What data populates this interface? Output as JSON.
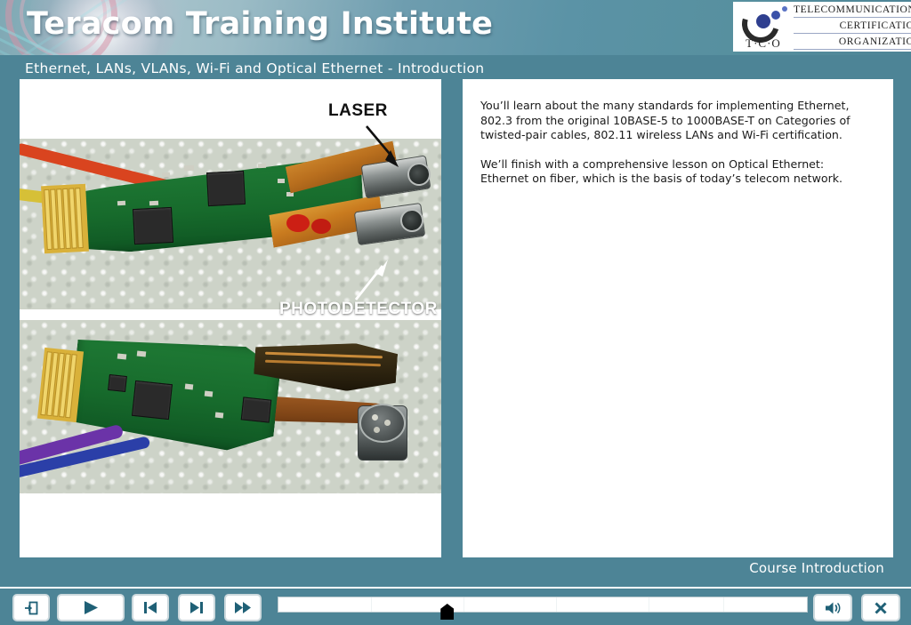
{
  "header": {
    "brand_title": "Teracom Training Institute",
    "subtitle": "Ethernet, LANs, VLANs, Wi-Fi and Optical Ethernet - Introduction",
    "logo": {
      "mark_text": "T·C·O",
      "line1": "TELECOMMUNICATIONS",
      "line2": "CERTIFICATION",
      "line3": "ORGANIZATION"
    }
  },
  "slide": {
    "image_callouts": {
      "laser": "LASER",
      "photodetector": "PHOTODETECTOR"
    },
    "body_paragraph_1": "You’ll learn about the many standards for implementing Ethernet, 802.3 from the original 10BASE-5 to 1000BASE-T on Categories of twisted-pair cables, 802.11 wireless LANs and Wi-Fi certification.",
    "body_paragraph_2": "We’ll finish with a comprehensive lesson on Optical Ethernet: Ethernet on fiber, which is the basis of today’s telecom network.",
    "course_label": "Course Introduction"
  },
  "controls": {
    "exit": "exit-icon",
    "play": "play-icon",
    "previous": "previous-icon",
    "next": "next-icon",
    "fast_forward": "fast-forward-icon",
    "volume": "volume-icon",
    "close": "close-icon",
    "progress_percent": 32
  },
  "colors": {
    "teal_background": "#4d8496",
    "panel_white": "#ffffff",
    "icon_teal": "#1f6076",
    "header_gradient_light": "#a8c4cc"
  }
}
